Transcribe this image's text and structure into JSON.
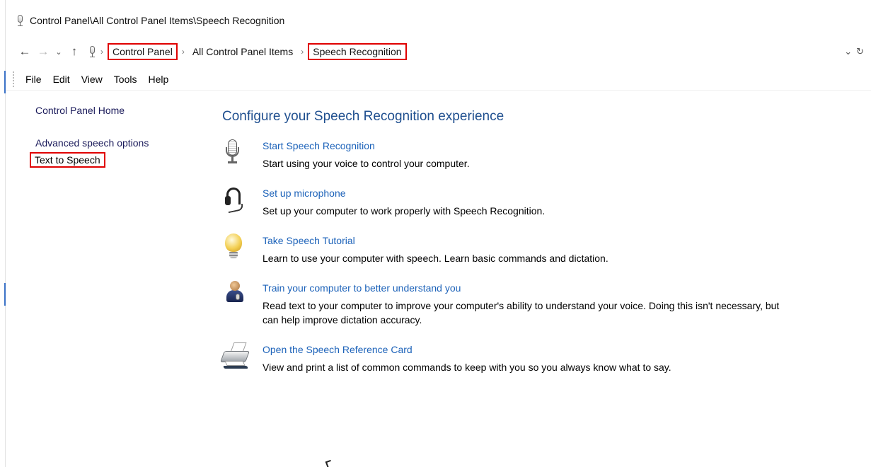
{
  "window": {
    "title": "Control Panel\\All Control Panel Items\\Speech Recognition",
    "app_icon": "microphone-icon"
  },
  "navigation": {
    "back_icon": "back-arrow-icon",
    "forward_icon": "forward-arrow-icon",
    "recent_icon": "chevron-down-icon",
    "up_icon": "up-arrow-icon",
    "breadcrumb": [
      {
        "label": "Control Panel",
        "highlighted": true
      },
      {
        "label": "All Control Panel Items",
        "highlighted": false
      },
      {
        "label": "Speech Recognition",
        "highlighted": true
      }
    ],
    "dropdown_icon": "chevron-down-icon",
    "refresh_icon": "refresh-icon"
  },
  "menu": [
    "File",
    "Edit",
    "View",
    "Tools",
    "Help"
  ],
  "sidebar": {
    "items": [
      {
        "label": "Control Panel Home"
      },
      {
        "label": "Advanced speech options"
      },
      {
        "label": "Text to Speech",
        "highlighted": true
      }
    ]
  },
  "main": {
    "heading": "Configure your Speech Recognition experience",
    "tasks": [
      {
        "icon": "microphone-icon",
        "title": "Start Speech Recognition",
        "description": "Start using your voice to control your computer."
      },
      {
        "icon": "headset-icon",
        "title": "Set up microphone",
        "description": "Set up your computer to work properly with Speech Recognition."
      },
      {
        "icon": "light-bulb-icon",
        "title": "Take Speech Tutorial",
        "description": "Learn to use your computer with speech.  Learn basic commands and dictation."
      },
      {
        "icon": "person-microphone-icon",
        "title": "Train your computer to better understand you",
        "description": "Read text to your computer to improve your computer's ability to understand your voice.  Doing this isn't necessary, but can help improve dictation accuracy."
      },
      {
        "icon": "printer-icon",
        "title": "Open the Speech Reference Card",
        "description": "View and print a list of common commands to keep with you so you always know what to say."
      }
    ]
  },
  "colors": {
    "link": "#1c62b9",
    "heading": "#1f4f8f",
    "highlight_border": "#e00000"
  }
}
